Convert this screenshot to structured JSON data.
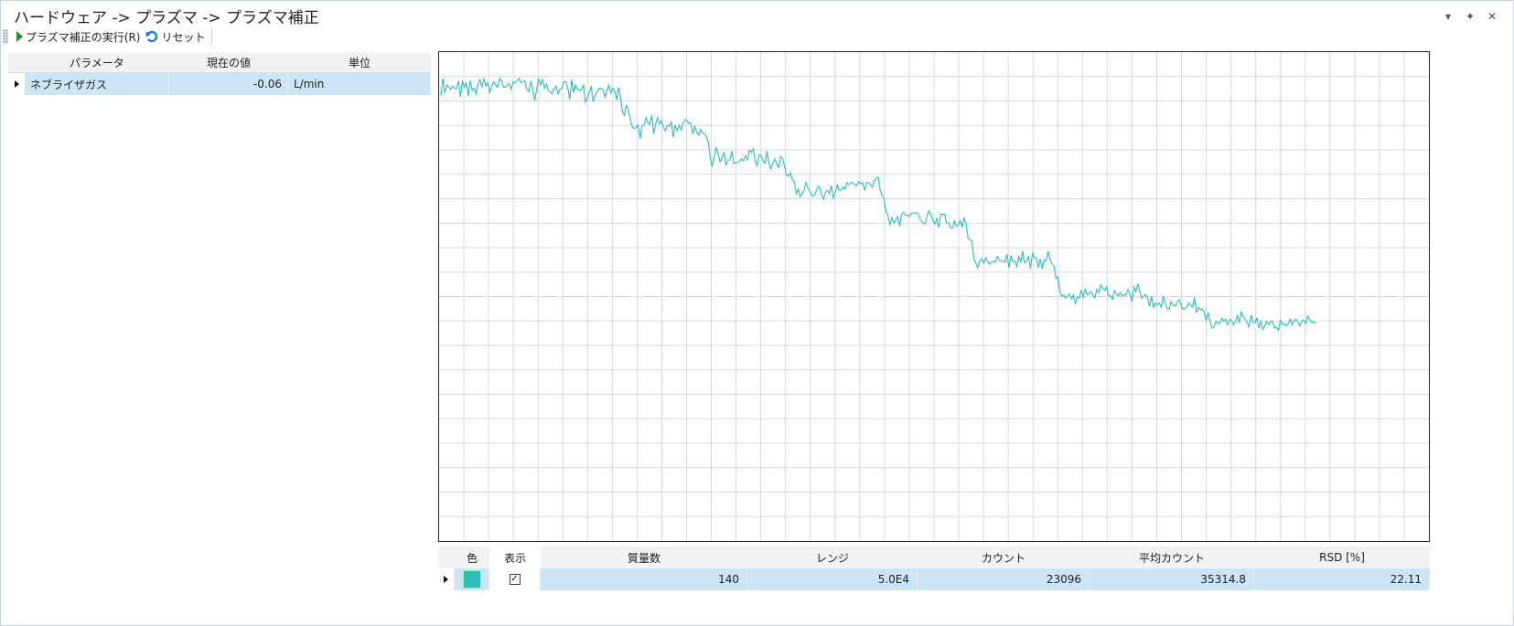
{
  "window": {
    "title": "ハードウェア -> プラズマ -> プラズマ補正",
    "controls": [
      "▾",
      "✦",
      "✕"
    ]
  },
  "toolbar": {
    "run_label": "プラズマ補正の実行(R)",
    "reset_label": "リセット"
  },
  "params_table": {
    "headers": [
      "パラメータ",
      "現在の値",
      "単位"
    ],
    "rows": [
      {
        "parameter": "ネブライザガス",
        "value": "-0.06",
        "unit": "L/min"
      }
    ]
  },
  "chart_data": {
    "type": "line",
    "title": "",
    "xlabel": "",
    "ylabel": "",
    "grid": true,
    "series": [
      {
        "color": "#2bbcbc",
        "y": [
          53,
          37,
          50,
          43,
          45,
          47,
          44,
          46,
          46,
          39,
          54,
          39,
          45,
          41,
          53,
          39,
          48,
          46,
          51,
          42,
          38,
          45,
          37,
          44,
          41,
          50,
          44,
          40,
          43,
          45,
          37,
          39,
          45,
          45,
          43,
          42,
          47,
          40,
          41,
          39,
          37,
          41,
          40,
          39,
          47,
          49,
          40,
          45,
          57,
          48,
          37,
          43,
          38,
          46,
          42,
          48,
          49,
          51,
          46,
          44,
          51,
          47,
          46,
          40,
          40,
          46,
          56,
          38,
          50,
          43,
          47,
          48,
          47,
          43,
          59,
          55,
          50,
          44,
          58,
          52,
          49,
          46,
          46,
          47,
          54,
          48,
          43,
          50,
          46,
          48,
          55,
          40,
          46,
          56,
          55,
          42,
          44,
          48,
          52,
          51,
          50,
          48,
          60,
          48,
          48,
          41,
          46,
          47,
          39,
          56,
          47,
          41,
          47,
          44,
          50,
          53,
          48,
          49,
          45,
          59,
          48,
          53,
          48,
          52,
          46,
          43,
          44,
          46,
          46,
          56,
          49,
          54,
          57,
          52,
          55,
          52,
          49,
          48,
          57,
          59,
          49,
          42,
          47,
          55,
          51,
          46,
          58,
          53,
          53,
          45,
          56,
          56,
          55,
          54,
          52,
          54,
          49,
          53,
          44,
          46,
          43,
          55,
          58,
          48,
          49,
          54,
          56,
          45,
          56,
          61,
          56,
          52,
          56,
          60,
          50,
          51,
          55,
          60,
          58,
          52,
          55,
          54,
          62,
          55,
          60,
          57,
          54,
          47,
          52,
          55,
          59,
          59,
          56,
          51,
          51,
          58,
          62,
          55,
          54,
          57,
          50,
          61,
          56,
          49,
          54,
          54,
          51,
          53,
          47,
          49,
          47,
          47,
          49,
          50,
          46,
          48,
          47,
          54,
          47,
          47,
          49,
          51,
          45,
          43,
          42,
          47,
          45,
          41,
          46,
          46,
          55,
          48,
          53,
          51,
          47,
          56,
          45,
          43,
          46,
          46,
          47,
          44,
          44,
          44,
          44,
          47,
          51,
          53,
          54,
          47,
          42,
          45,
          51,
          54,
          49,
          57,
          45,
          45,
          45,
          53,
          53,
          57,
          58,
          51,
          56,
          55,
          51,
          57,
          48,
          52,
          58,
          53,
          47,
          56,
          58,
          62,
          56,
          54,
          58,
          53,
          56,
          59,
          57,
          56,
          57,
          52,
          55,
          56,
          56,
          57,
          50,
          62,
          51,
          56,
          56,
          61,
          52,
          57,
          47,
          58,
          56,
          52,
          63,
          49,
          53,
          53,
          62,
          54,
          63,
          55,
          56,
          47,
          55,
          58,
          58,
          62,
          54,
          60,
          58,
          56,
          59,
          57,
          55,
          60,
          56,
          64,
          58,
          59,
          52,
          58,
          51,
          56,
          55,
          53,
          56,
          59,
          51,
          54,
          47,
          50,
          52,
          49,
          57,
          57,
          60,
          52,
          55,
          57,
          54,
          57,
          56,
          56,
          51,
          56,
          62,
          49,
          53,
          46,
          53,
          58,
          54,
          51,
          52,
          58,
          49,
          59,
          55,
          57,
          55,
          59,
          49,
          55,
          60,
          61,
          54,
          57,
          58,
          55,
          52,
          56,
          61,
          60,
          59,
          55,
          57,
          59,
          50,
          64,
          59,
          61,
          60,
          59,
          64,
          53,
          58,
          63,
          62,
          57,
          58,
          59,
          54,
          57,
          55,
          60,
          55,
          56,
          60,
          57,
          52,
          58,
          48,
          52,
          55,
          58,
          62,
          51,
          58,
          58,
          54,
          63,
          57,
          64,
          61,
          57,
          60,
          57,
          57,
          63,
          62,
          65,
          56,
          60,
          59,
          61,
          59,
          55,
          60,
          56,
          55,
          58,
          61,
          56,
          56,
          59,
          52,
          55,
          58,
          57,
          59
        ]
      }
    ]
  },
  "bottom_table": {
    "headers": [
      "色",
      "表示",
      "質量数",
      "レンジ",
      "カウント",
      "平均カウント",
      "RSD [%]"
    ],
    "rows": [
      {
        "color": "#2fbcbc",
        "show": true,
        "show_glyph": "✓",
        "mass": "140",
        "range": "5.0E4",
        "count": "23096",
        "avg_count": "35314.8",
        "rsd": "22.11"
      }
    ]
  }
}
